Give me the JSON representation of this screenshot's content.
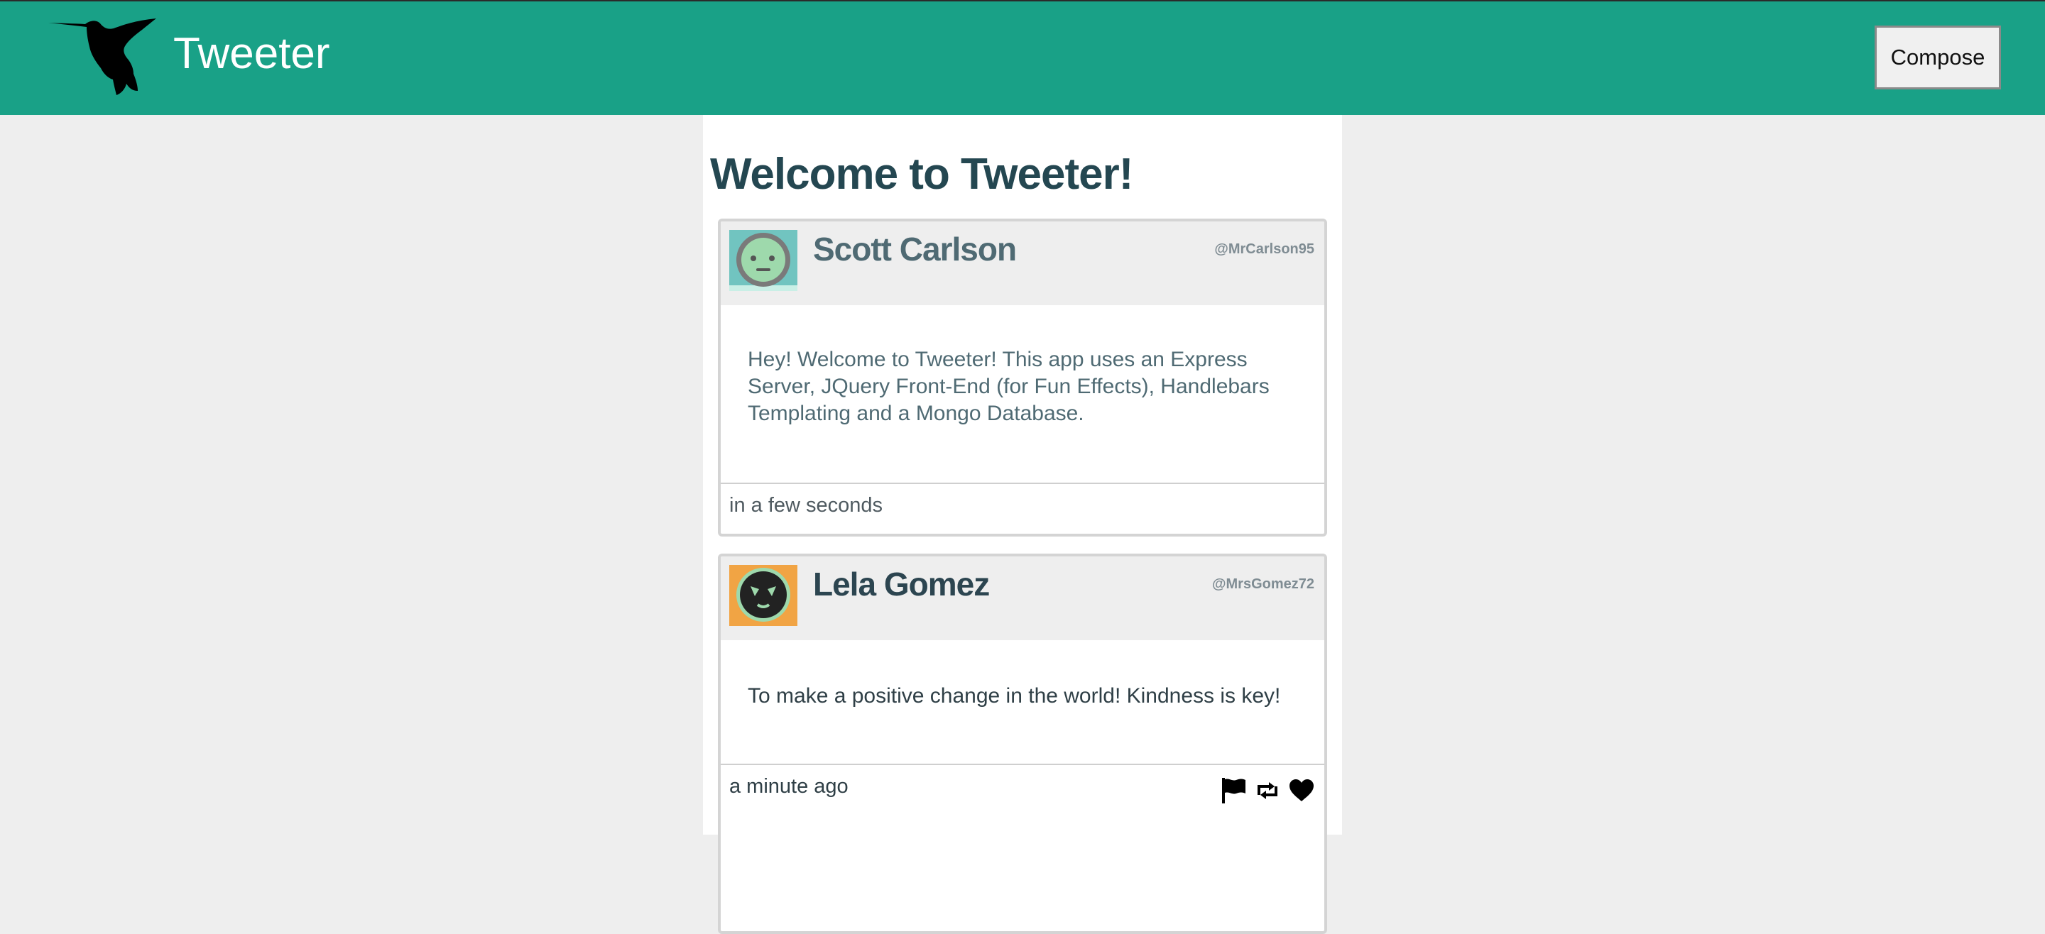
{
  "app": {
    "brand": "Tweeter",
    "compose_label": "Compose"
  },
  "page": {
    "title": "Welcome to Tweeter!"
  },
  "colors": {
    "navbar": "#19a187",
    "title": "#244751",
    "header_bg": "#eeeeee"
  },
  "tweets": [
    {
      "name": "Scott Carlson",
      "handle": "@MrCarlson95",
      "body": "Hey! Welcome to Tweeter! This app uses an Express Server, JQuery Front-End (for Fun Effects), Handlebars Templating and a Mongo Database.",
      "time": "in a few seconds",
      "avatar_icon": "robot-face-icon"
    },
    {
      "name": "Lela Gomez",
      "handle": "@MrsGomez72",
      "body": "To make a positive change in the world! Kindness is key!",
      "time": "a minute ago",
      "avatar_icon": "robot-face-icon",
      "actions": [
        "flag-icon",
        "retweet-icon",
        "heart-icon"
      ]
    }
  ]
}
